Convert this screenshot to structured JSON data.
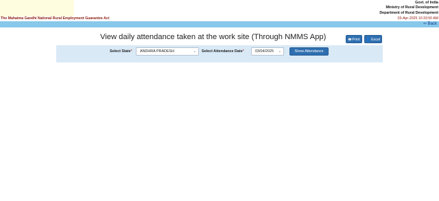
{
  "header": {
    "gov_lines": [
      "Govt. of India",
      "Ministry of Rural Development",
      "Department of Rural Development"
    ],
    "act_name": "The Mahatma Gandhi National Rural Employment Guarantee Act",
    "datetime": "03-Apr-2025 10:33:50 AM"
  },
  "nav": {
    "back_label": "Back",
    "back_icon": "back-arrow-icon"
  },
  "page": {
    "title": "View daily attendance taken at the work site (Through NMMS App)"
  },
  "actions": {
    "print_label": "Print",
    "print_icon": "printer-icon",
    "excel_label": "Excel",
    "excel_icon": "user-icon"
  },
  "filters": {
    "state_label": "Select State",
    "state_value": "ANDHRA PRADESH",
    "date_label": "Select Attendance Date",
    "date_value": "03/04/2025",
    "required_mark": "*",
    "show_button_label": "Show Attendance"
  }
}
